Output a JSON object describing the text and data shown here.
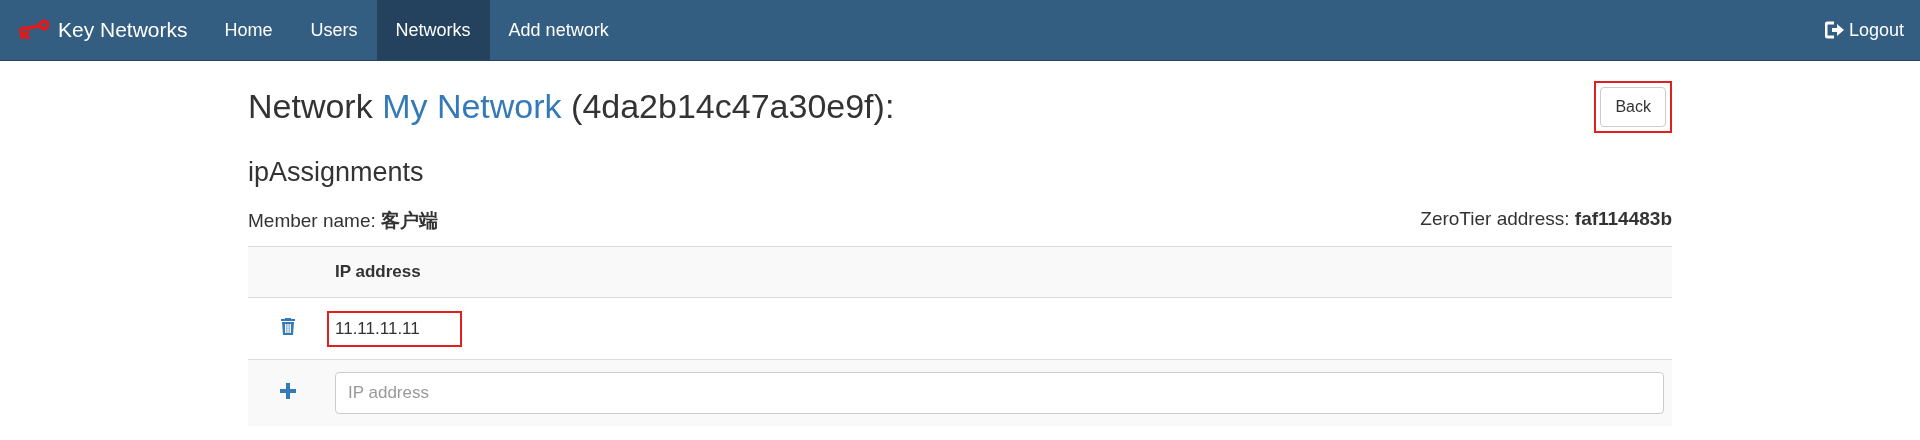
{
  "navbar": {
    "brand": "Key Networks",
    "items": [
      {
        "label": "Home",
        "selected": false
      },
      {
        "label": "Users",
        "selected": false
      },
      {
        "label": "Networks",
        "selected": true
      },
      {
        "label": "Add network",
        "selected": false
      }
    ],
    "logout": "Logout"
  },
  "heading": {
    "prefix": "Network",
    "name": "My Network",
    "suffix": "(4da2b14c47a30e9f):"
  },
  "back_button": {
    "label": "Back",
    "highlighted": true
  },
  "section_title": "ipAssignments",
  "member": {
    "name": "Member name: **客户端**",
    "address": "ZeroTier address: **faf114483b**"
  },
  "table": {
    "columns": [
      "IP address"
    ],
    "rows": [
      {
        "ip": "11.11.11.11",
        "highlighted": true
      }
    ],
    "new_row": {
      "placeholder": "IP address"
    }
  }
}
